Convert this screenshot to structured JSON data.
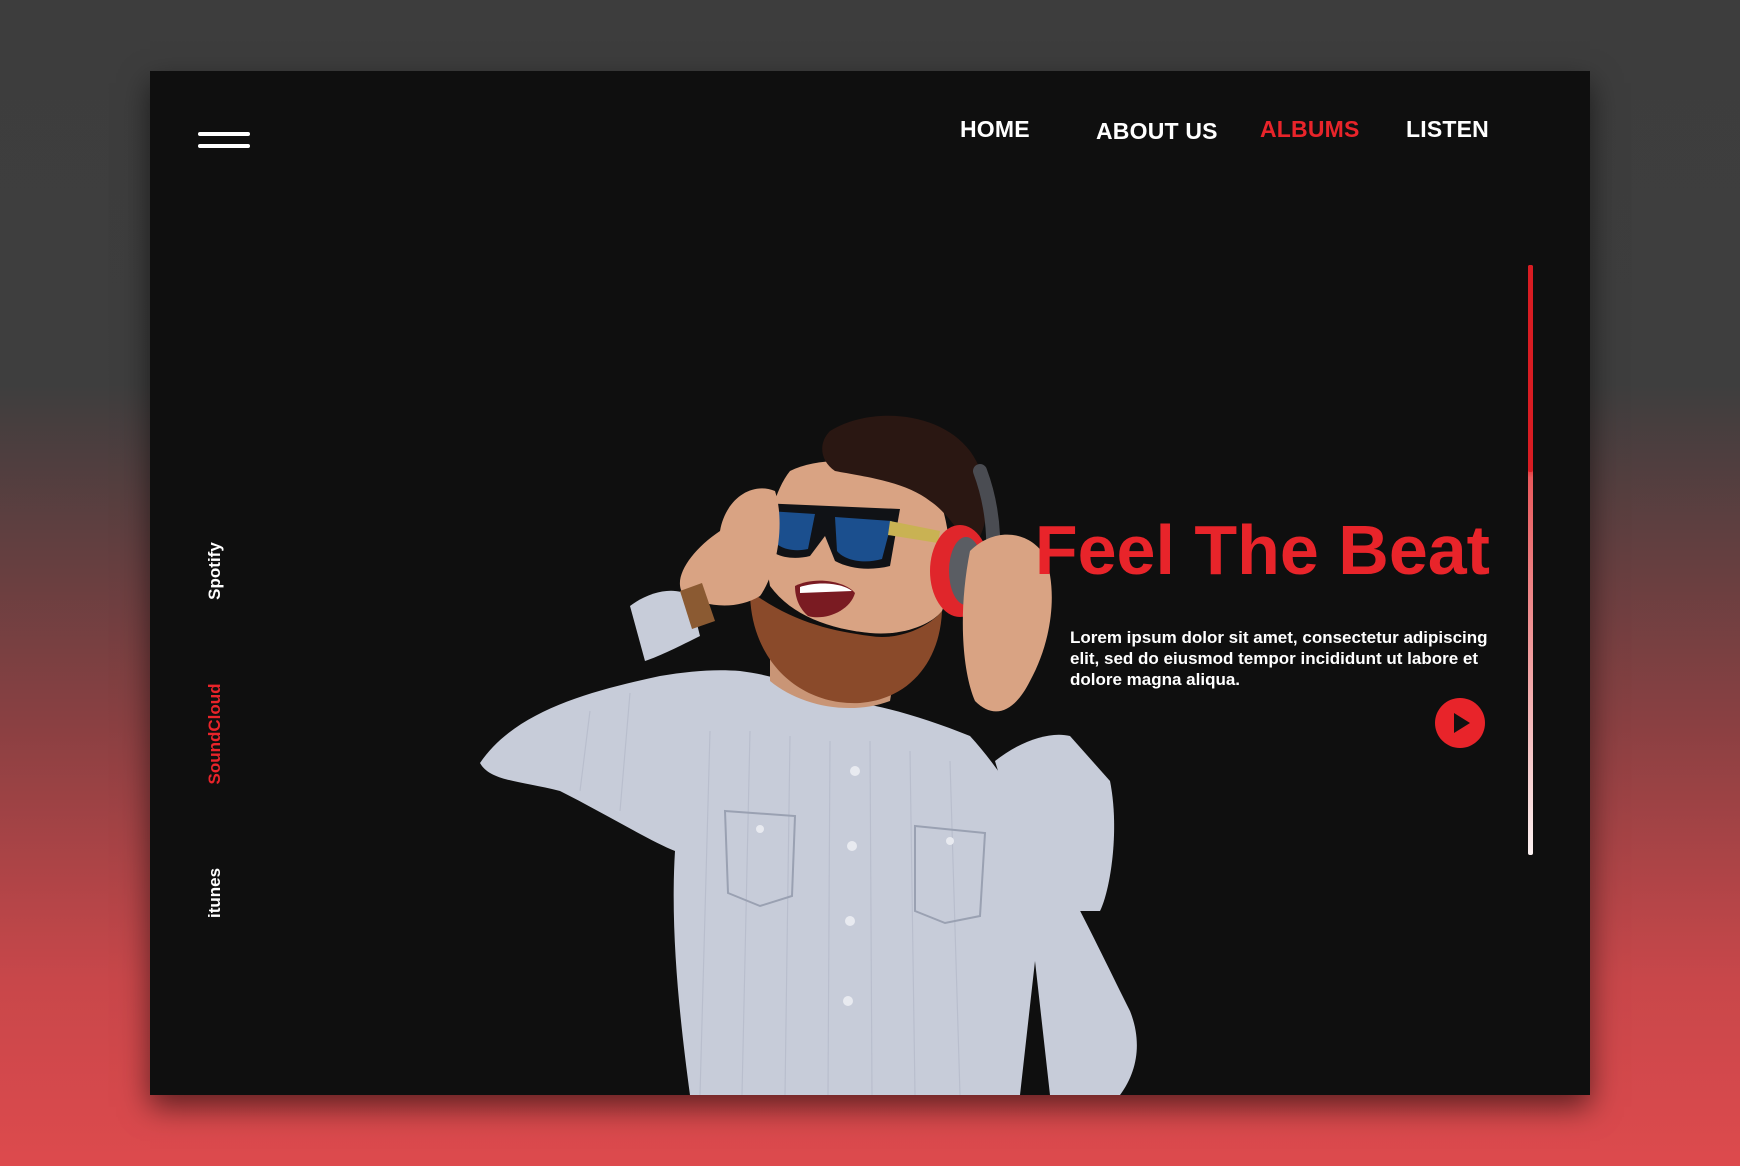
{
  "theme": {
    "accent": "#e8242a",
    "card_background": "#0f0f0f",
    "text_color": "#ffffff"
  },
  "nav": {
    "items": [
      {
        "label": "HOME",
        "active": false
      },
      {
        "label": "ABOUT US",
        "active": false
      },
      {
        "label": "ALBUMS",
        "active": true
      },
      {
        "label": "LISTEN",
        "active": false
      }
    ]
  },
  "menu": {
    "icon": "hamburger-menu-icon"
  },
  "side_links": [
    {
      "label": "Spotify",
      "active": false
    },
    {
      "label": "SoundCloud",
      "active": true
    },
    {
      "label": "itunes",
      "active": false
    }
  ],
  "hero": {
    "title": "Feel The Beat",
    "text": "Lorem ipsum dolor sit amet, consectetur adipiscing elit, sed do eiusmod tempor incididunt ut labore et dolore magna aliqua.",
    "play_icon": "play-icon"
  },
  "scroll": {
    "progress": 0.35
  }
}
